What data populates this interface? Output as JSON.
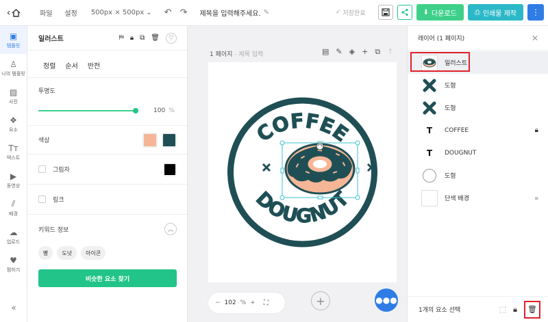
{
  "topbar": {
    "menu_file": "파일",
    "menu_settings": "설정",
    "size": "500px × 500px",
    "title_placeholder": "제목을 입력해주세요.",
    "saved": "저장완료",
    "download": "다운로드",
    "print": "인쇄물 제작"
  },
  "leftnav": [
    {
      "label": "템플릿",
      "icon": "▣",
      "name": "template"
    },
    {
      "label": "나의 템플릿",
      "icon": "♙",
      "name": "my-template"
    },
    {
      "label": "사진",
      "icon": "▨",
      "name": "photo"
    },
    {
      "label": "요소",
      "icon": "❖",
      "name": "element"
    },
    {
      "label": "텍스트",
      "icon": "Tт",
      "name": "text"
    },
    {
      "label": "동영상",
      "icon": "▶",
      "name": "video"
    },
    {
      "label": "배경",
      "icon": "⫽",
      "name": "background"
    },
    {
      "label": "업로드",
      "icon": "☁",
      "name": "upload"
    },
    {
      "label": "찜하기",
      "icon": "♥",
      "name": "favorites"
    }
  ],
  "props": {
    "title": "일러스트",
    "tabs": [
      "정렬",
      "순서",
      "반전"
    ],
    "opacity_label": "투명도",
    "opacity_value": "100",
    "opacity_unit": "%",
    "opacity_fraction": 1.0,
    "color_label": "색상",
    "colors": [
      "#f5b697",
      "#1f4f55"
    ],
    "shadow_label": "그림자",
    "shadow_color": "#000000",
    "link_label": "링크",
    "keyword_label": "키워드 정보",
    "tags": [
      "빵",
      "도넛",
      "아이콘"
    ],
    "similar_button": "비슷한 요소 찾기"
  },
  "canvas": {
    "page_label": "1 페이지",
    "page_sub": " - 제목 입력",
    "zoom_value": "102",
    "zoom_unit": "%",
    "logo_top": "COFFEE",
    "logo_bottom": "DOUGNUT"
  },
  "layers": {
    "title": "레이어 (1 페이지)",
    "items": [
      {
        "label": "일러스트",
        "thumb": "donut",
        "selected": true
      },
      {
        "label": "도형",
        "thumb": "x-shape"
      },
      {
        "label": "도형",
        "thumb": "x-shape"
      },
      {
        "label": "COFFEE",
        "thumb": "T",
        "locked": true
      },
      {
        "label": "DOUGNUT",
        "thumb": "T"
      },
      {
        "label": "도형",
        "thumb": "circle"
      },
      {
        "label": "단색 배경",
        "thumb": "blank",
        "locked_dim": true
      }
    ],
    "selection_count": "1개의 요소 선택"
  }
}
